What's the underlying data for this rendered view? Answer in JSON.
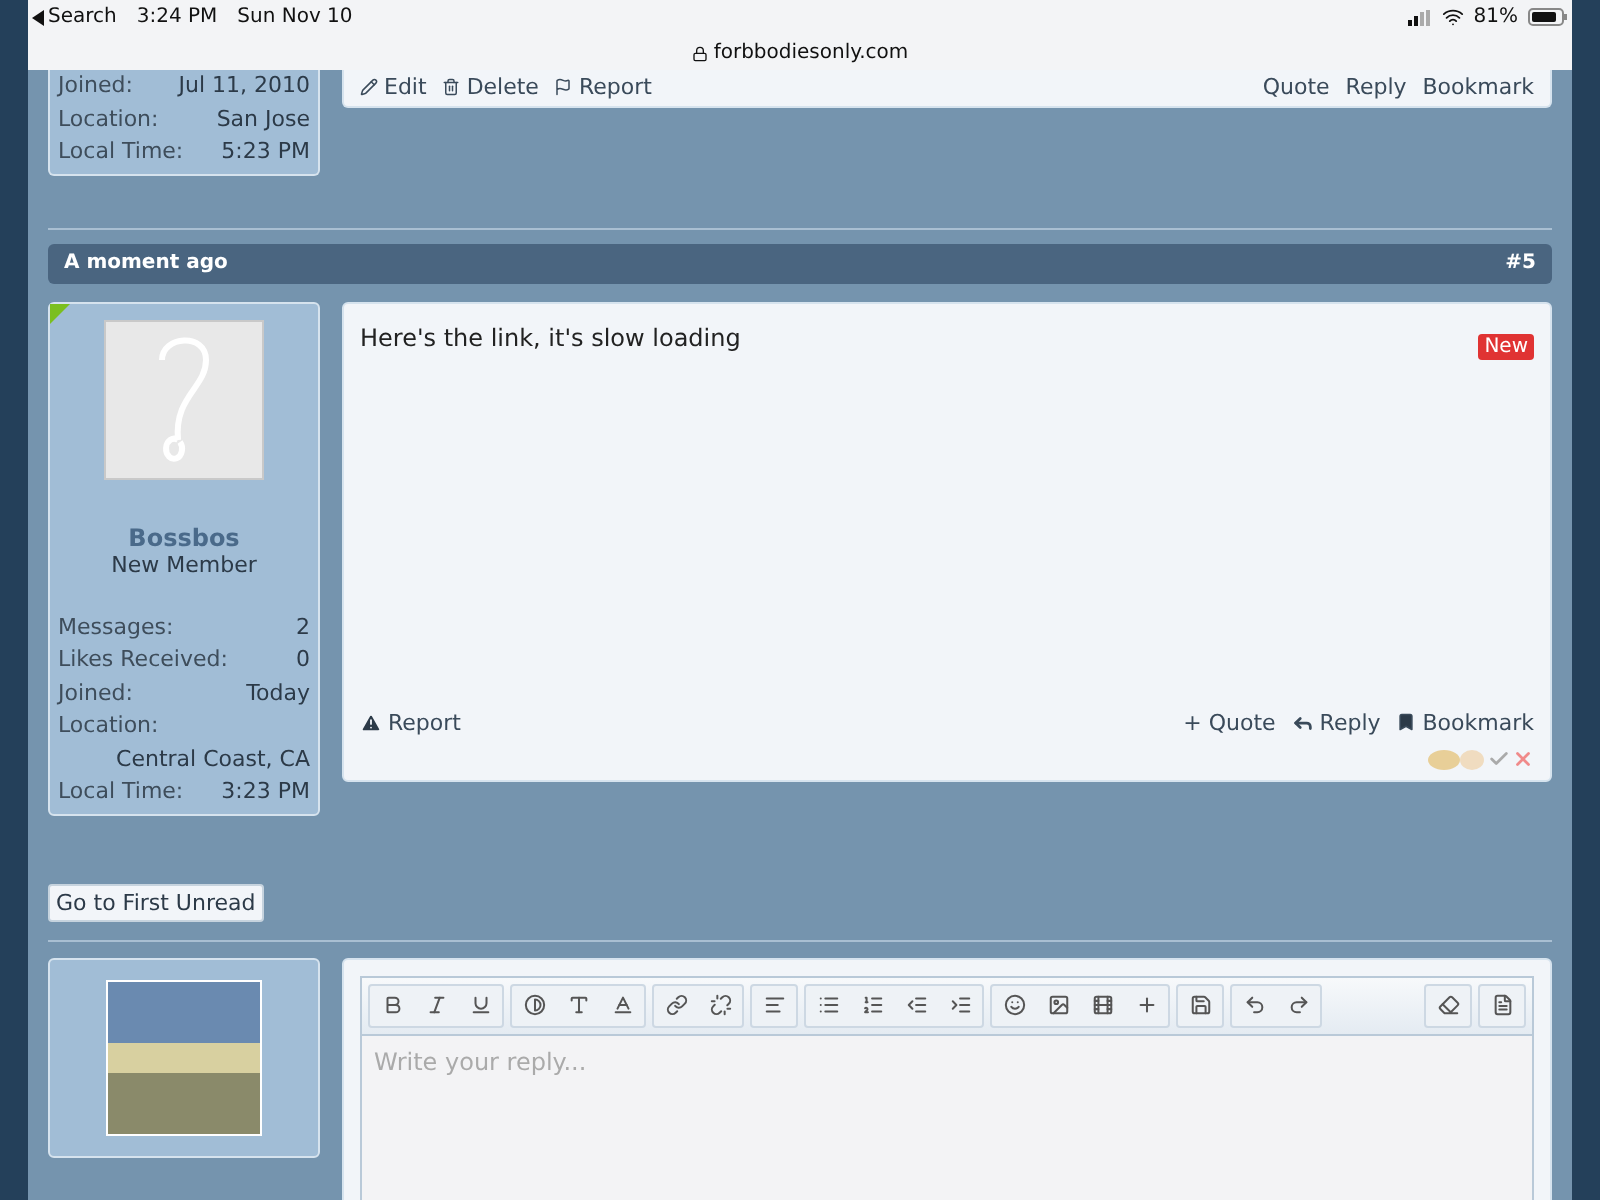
{
  "status_bar": {
    "back": "Search",
    "time": "3:24 PM",
    "date": "Sun Nov 10",
    "url": "forbbodiesonly.com",
    "battery": "81%"
  },
  "previous_post": {
    "stats": [
      {
        "label": "Joined:",
        "value": "Jul 11, 2010"
      },
      {
        "label": "Location:",
        "value": "San Jose"
      },
      {
        "label": "Local Time:",
        "value": "5:23 PM"
      }
    ],
    "left_actions": [
      "Edit",
      "Delete",
      "Report"
    ],
    "right_actions": [
      "Quote",
      "Reply",
      "Bookmark"
    ]
  },
  "post": {
    "time": "A moment ago",
    "number": "#5",
    "online": true,
    "username": "Bossbos",
    "title": "New Member",
    "stats": [
      {
        "label": "Messages:",
        "value": "2",
        "wrap": false
      },
      {
        "label": "Likes Received:",
        "value": "0",
        "wrap": false
      },
      {
        "label": "Joined:",
        "value": "Today",
        "wrap": false
      },
      {
        "label": "Location:",
        "value": "Central Coast, CA",
        "wrap": true
      },
      {
        "label": "Local Time:",
        "value": "3:23 PM",
        "wrap": false
      }
    ],
    "body": "Here's the link, it's slow loading",
    "badge": "New",
    "report": "Report",
    "quote": "+ Quote",
    "reply": "Reply",
    "bookmark": "Bookmark"
  },
  "first_unread": "Go to First Unread",
  "editor": {
    "placeholder": "Write your reply..."
  }
}
